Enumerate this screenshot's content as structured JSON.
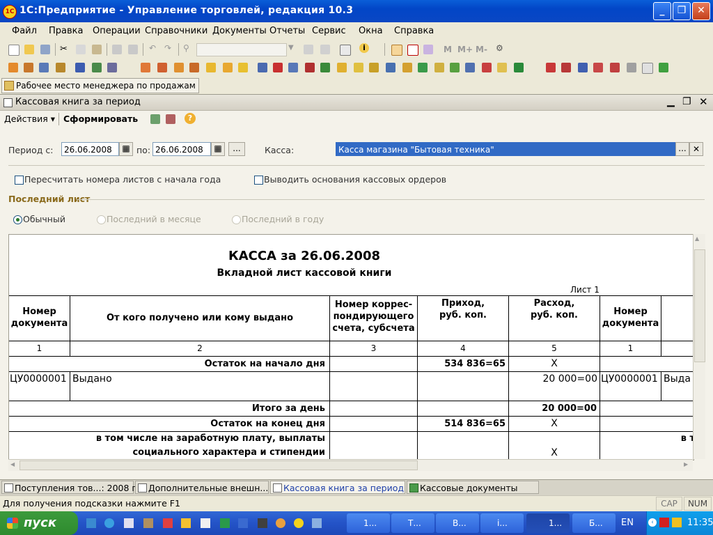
{
  "window": {
    "title": "1С:Предприятие - Управление торговлей, редакция 10.3",
    "logo": "1C"
  },
  "menu": [
    "Файл",
    "Правка",
    "Операции",
    "Справочники",
    "Документы",
    "Отчеты",
    "Сервис",
    "Окна",
    "Справка"
  ],
  "toolbar2": {
    "m1": "M",
    "m2": "M+",
    "m3": "M-"
  },
  "panel": {
    "label": "Рабочее место менеджера по продажам"
  },
  "child": {
    "title": "Кассовая книга за период",
    "actions_label": "Действия",
    "generate_label": "Сформировать",
    "help_label": "?"
  },
  "form": {
    "period_from_label": "Период с:",
    "period_from": "26.06.2008",
    "period_to_label": "по:",
    "period_to": "26.06.2008",
    "ellipsis": "...",
    "kassa_label": "Касса:",
    "kassa_value": "Касса магазина \"Бытовая техника\"",
    "recalc_label": "Пересчитать номера листов с начала года",
    "show_basis_label": "Выводить основания кассовых ордеров",
    "last_sheet_header": "Последний лист",
    "radio_normal": "Обычный",
    "radio_month": "Последний в месяце",
    "radio_year": "Последний в году"
  },
  "report": {
    "title": "КАССА за 26.06.2008",
    "subtitle": "Вкладной лист кассовой книги",
    "sheet": "Лист 1",
    "headers": [
      "Номер документа",
      "От кого получено или кому выдано",
      "Номер коррес-пондирующего счета, субсчета",
      "Приход, руб. коп.",
      "Расход, руб. коп.",
      "Номер документа"
    ],
    "col_numbers": [
      "1",
      "2",
      "3",
      "4",
      "5",
      "1"
    ],
    "rows": {
      "opening_label": "Остаток на начало дня",
      "opening_income": "534 836=65",
      "opening_x": "Х",
      "doc_number": "ЦУ0000001",
      "doc_desc": "Выдано",
      "doc_expense": "20 000=00",
      "doc_number2": "ЦУ0000001",
      "doc_desc2": "Выда",
      "total_label": "Итого за день",
      "total_expense": "20 000=00",
      "closing_label": "Остаток на конец  дня",
      "closing_income": "514 836=65",
      "closing_x": "Х",
      "incl_label": "в том числе на заработную плату, выплаты социального характера и стипендии",
      "incl_x": "Х",
      "incl_right": "в то"
    }
  },
  "tabs": [
    "Поступления тов...: 2008 г.",
    "Дополнительные внешн...",
    "Кассовая книга за период",
    "Кассовые документы"
  ],
  "status": {
    "hint": "Для получения подсказки нажмите F1",
    "cap": "CAP",
    "num": "NUM"
  },
  "taskbar": {
    "start": "пуск",
    "tasks": [
      "1...",
      "Т...",
      "В...",
      "i...",
      "1...",
      "Б..."
    ],
    "lang": "EN",
    "time": "11:35"
  }
}
